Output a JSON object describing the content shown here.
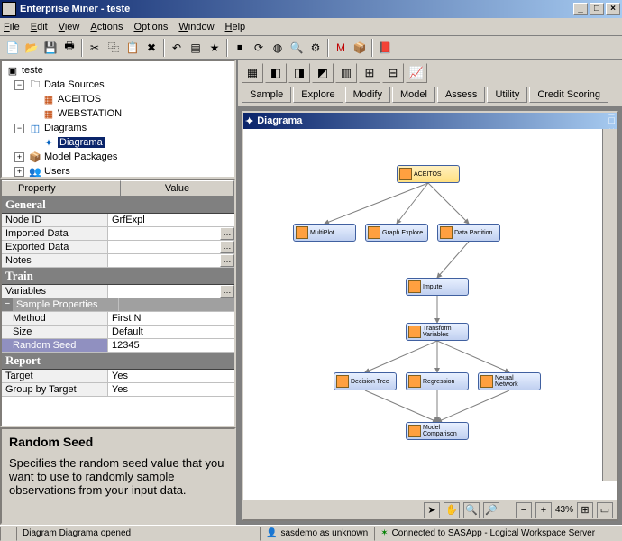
{
  "window": {
    "title": "Enterprise Miner - teste"
  },
  "menubar": [
    "File",
    "Edit",
    "View",
    "Actions",
    "Options",
    "Window",
    "Help"
  ],
  "tree": {
    "root": "teste",
    "data_sources": {
      "label": "Data Sources",
      "items": [
        "ACEITOS",
        "WEBSTATION"
      ]
    },
    "diagrams": {
      "label": "Diagrams",
      "items": [
        "Diagrama"
      ]
    },
    "model_packages": "Model Packages",
    "users": "Users"
  },
  "properties": {
    "header_property": "Property",
    "header_value": "Value",
    "sections": {
      "general": "General",
      "train": "Train",
      "sample_props": "Sample Properties",
      "report": "Report"
    },
    "rows": {
      "node_id": {
        "label": "Node ID",
        "value": "GrfExpl"
      },
      "imported": {
        "label": "Imported Data",
        "value": ""
      },
      "exported": {
        "label": "Exported Data",
        "value": ""
      },
      "notes": {
        "label": "Notes",
        "value": ""
      },
      "variables": {
        "label": "Variables",
        "value": ""
      },
      "method": {
        "label": "Method",
        "value": "First N"
      },
      "size": {
        "label": "Size",
        "value": "Default"
      },
      "random_seed": {
        "label": "Random Seed",
        "value": "12345"
      },
      "target": {
        "label": "Target",
        "value": "Yes"
      },
      "group_by_target": {
        "label": "Group by Target",
        "value": "Yes"
      }
    }
  },
  "help": {
    "title": "Random Seed",
    "body": "Specifies the random seed value that you want to use to randomly sample observations from your input data."
  },
  "right": {
    "tabs": [
      "Sample",
      "Explore",
      "Modify",
      "Model",
      "Assess",
      "Utility",
      "Credit Scoring"
    ],
    "diag_title": "Diagrama",
    "zoom": "43%",
    "nodes": {
      "aceitos": "ACEITOS",
      "multiplot": "MultiPlot",
      "graph_explore": "Graph Explore",
      "data_partition": "Data Partition",
      "impute": "Impute",
      "transform": "Transform Variables",
      "decision_tree": "Decision Tree",
      "regression": "Regression",
      "neural_net": "Neural Network",
      "model_comp": "Model Comparison"
    }
  },
  "status": {
    "left": "Diagram Diagrama opened",
    "mid": "sasdemo as unknown",
    "right": "Connected to SASApp - Logical Workspace Server"
  }
}
